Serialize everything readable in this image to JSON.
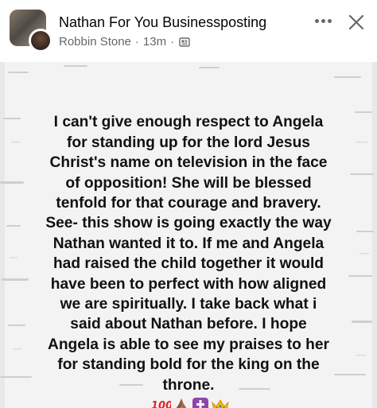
{
  "header": {
    "group_name": "Nathan For You Businessposting",
    "author": "Robbin Stone",
    "time": "13m",
    "separator": "·"
  },
  "post": {
    "text": "I can't give enough respect to Angela\nfor standing up for the lord Jesus\nChrist's name on television in the face\nof opposition! She will be blessed\ntenfold for that courage and bravery.\nSee- this show is going exactly the way\nNathan wanted it to. If me and Angela\nhad raised the child together it would\nhave been to perfect with how aligned\nwe are spiritually. I take back what i\nsaid about Nathan before. I hope\nAngela is able to see my praises to her\nfor standing bold for the king on the\nthrone.",
    "emojis": [
      "hundred-points-icon",
      "praying-hands-icon",
      "latin-cross-icon",
      "crown-icon"
    ]
  },
  "colors": {
    "secondary_text": "#65676b",
    "post_background": "#f4f4f4"
  }
}
